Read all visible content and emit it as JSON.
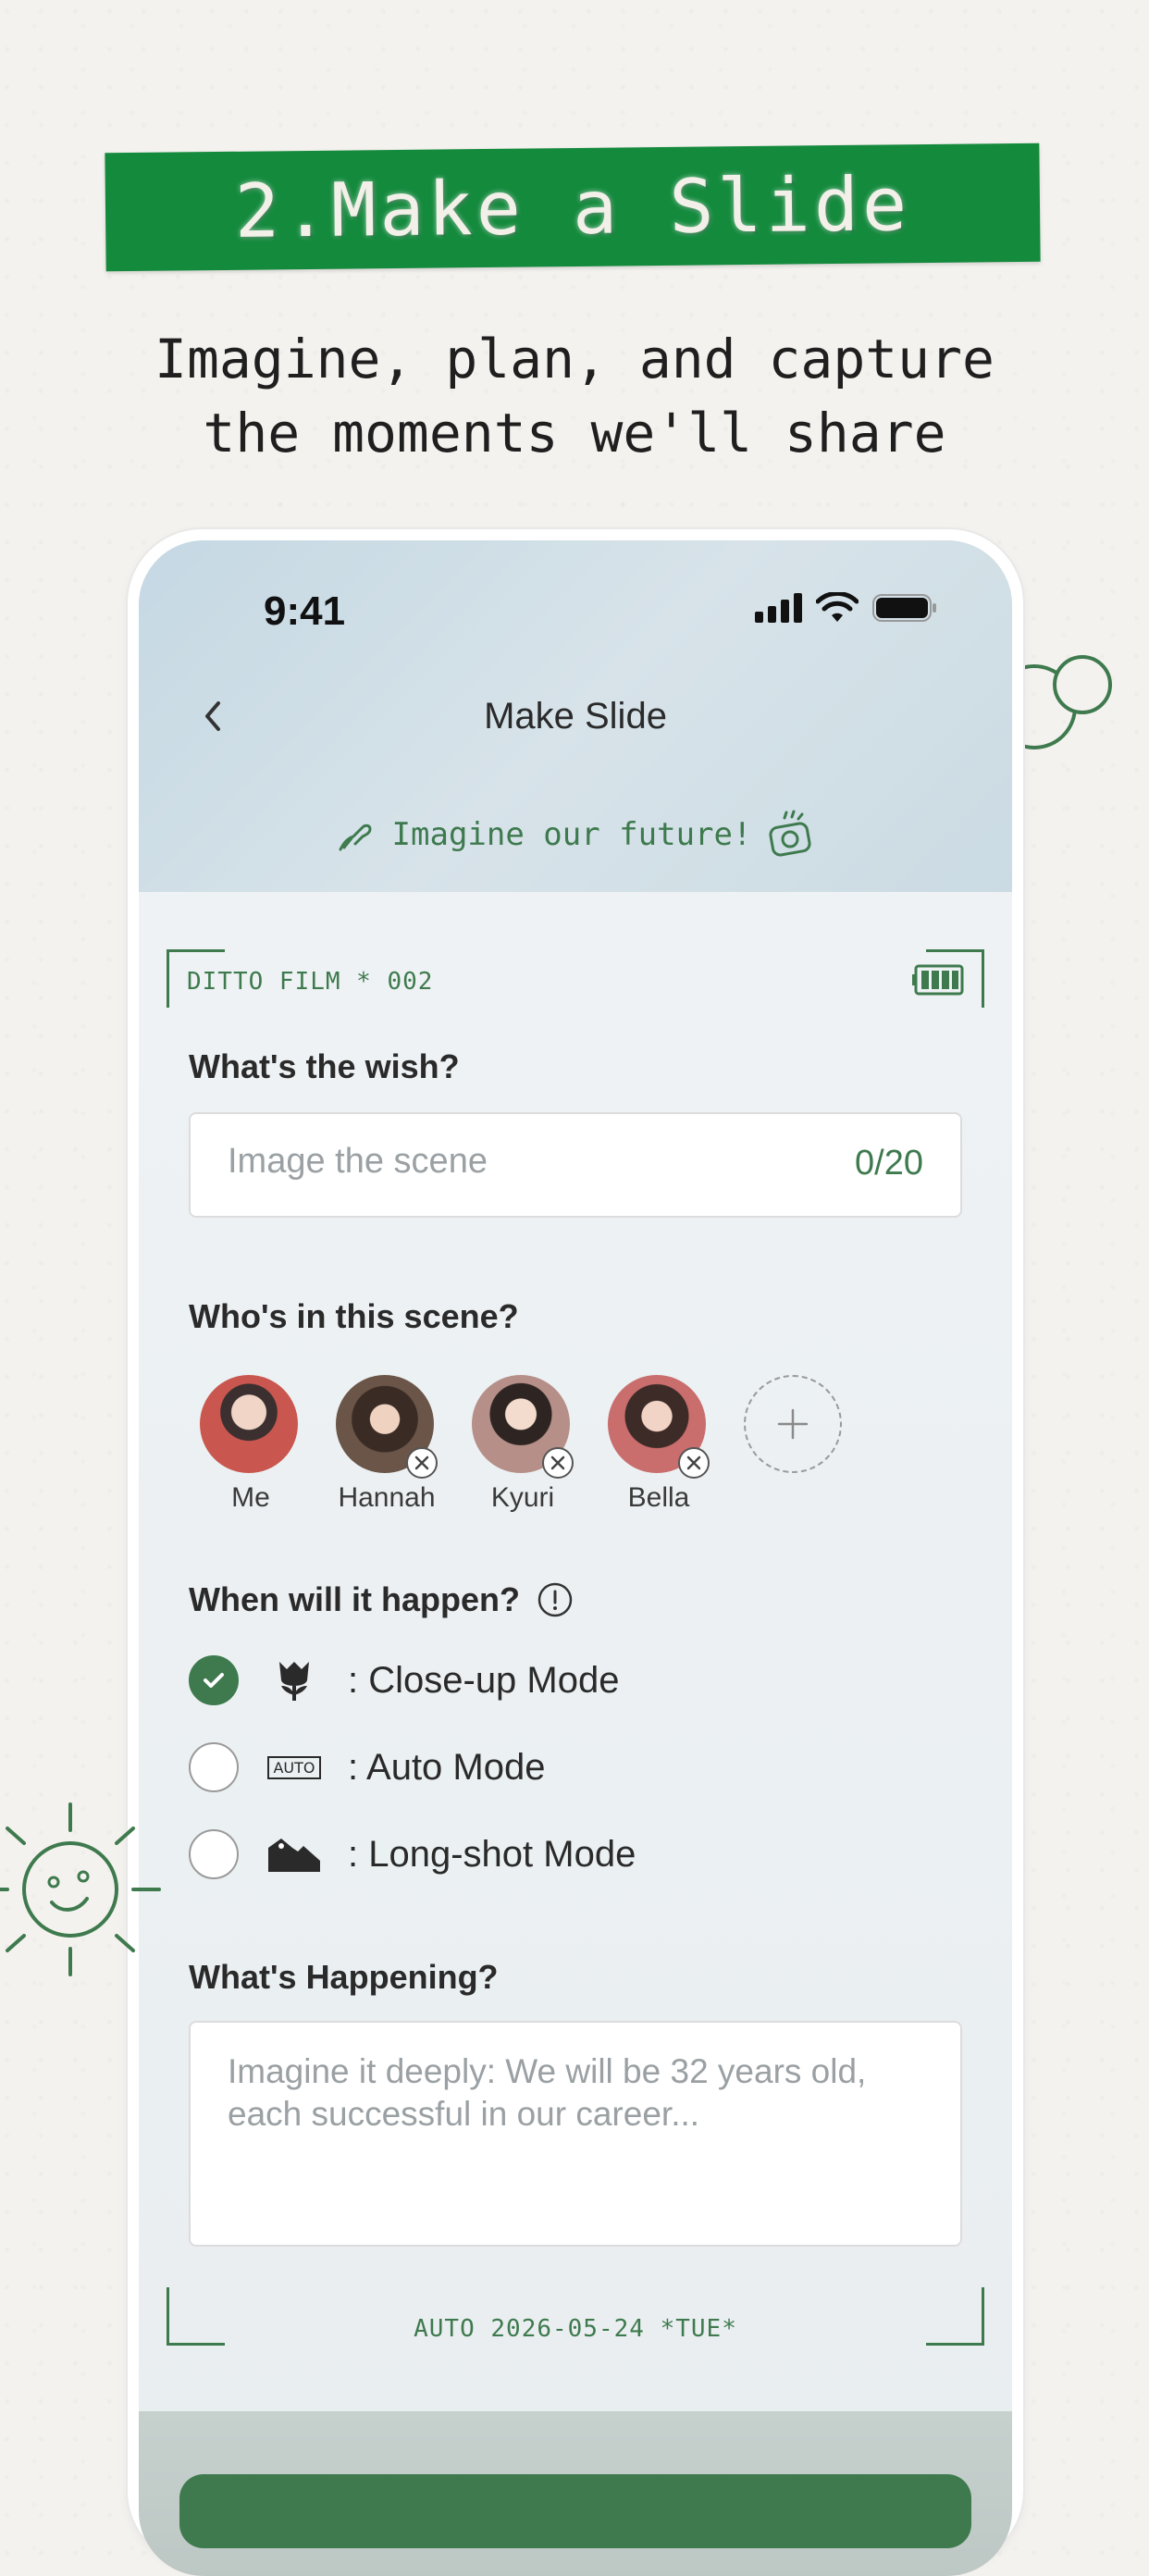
{
  "banner": {
    "title": "2.Make a Slide"
  },
  "subtitle": "Imagine, plan, and capture\nthe moments we'll share",
  "status_bar": {
    "time": "9:41"
  },
  "nav": {
    "title": "Make Slide"
  },
  "tagline": "Imagine our future!",
  "film": {
    "label": "DITTO FILM * 002"
  },
  "wish": {
    "label": "What's the wish?",
    "placeholder": "Image the scene",
    "counter": "0/20"
  },
  "scene": {
    "label": "Who's in this scene?",
    "people": [
      {
        "name": "Me",
        "removable": false
      },
      {
        "name": "Hannah",
        "removable": true
      },
      {
        "name": "Kyuri",
        "removable": true
      },
      {
        "name": "Bella",
        "removable": true
      }
    ]
  },
  "when": {
    "label": "When will it happen?",
    "modes": [
      {
        "label": ": Close-up Mode",
        "icon": "tulip-icon",
        "checked": true
      },
      {
        "label": ": Auto Mode",
        "icon": "auto-icon",
        "checked": false
      },
      {
        "label": ": Long-shot Mode",
        "icon": "mountain-icon",
        "checked": false
      }
    ],
    "auto_icon_text": "AUTO"
  },
  "happening": {
    "label": "What's Happening?",
    "placeholder": "Imagine it deeply: We will be 32 years old, each successful in our career..."
  },
  "footer_stamp": "AUTO  2026-05-24  *TUE*",
  "colors": {
    "accent": "#3e7a4e",
    "banner": "#148a3d"
  }
}
